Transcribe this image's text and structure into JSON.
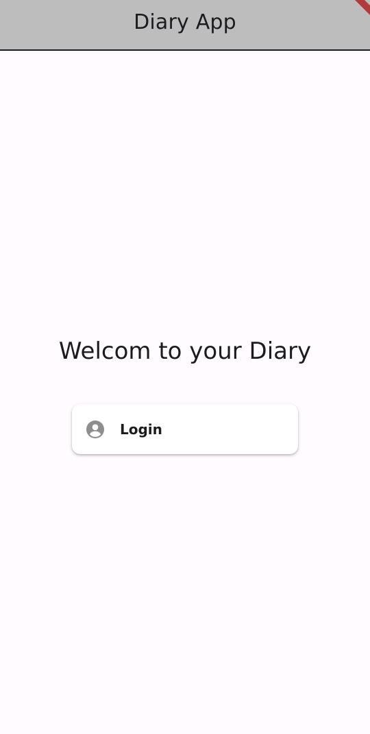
{
  "app_bar": {
    "title": "Diary App"
  },
  "main": {
    "welcome_text": "Welcom to your Diary",
    "login_button": {
      "label": "Login",
      "icon": "account-circle-icon"
    }
  },
  "colors": {
    "app_bar_background": "#bdbdbd",
    "page_background": "#fffbfe",
    "text": "#1c1b1f",
    "icon": "#8e8e8e",
    "debug_banner": "#b13b3b"
  }
}
